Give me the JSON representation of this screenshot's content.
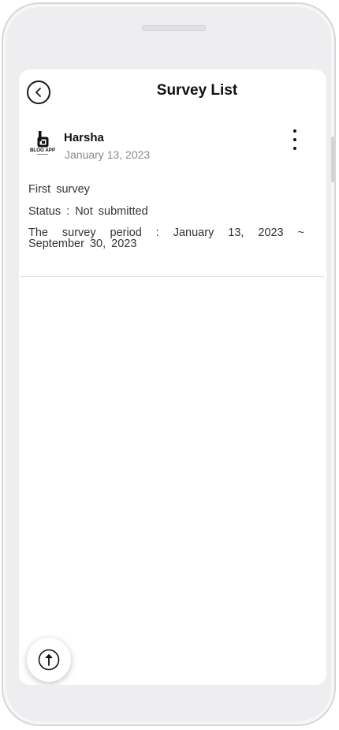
{
  "header": {
    "title": "Survey List",
    "back_icon": "chevron-left-icon"
  },
  "survey": {
    "author": {
      "name": "Harsha",
      "date": "January 13, 2023",
      "logo_text": "BLOG APP"
    },
    "menu_icon": "more-vertical-icon",
    "title": "First survey",
    "status": "Status : Not submitted",
    "period": "The survey period : January 13, 2023 ~ September 30, 2023"
  },
  "fab": {
    "icon": "arrow-up-circle-icon"
  },
  "colors": {
    "frame": "#eeeef0",
    "screen": "#ffffff",
    "text_primary": "#111111",
    "text_secondary": "#8a8a8a"
  }
}
